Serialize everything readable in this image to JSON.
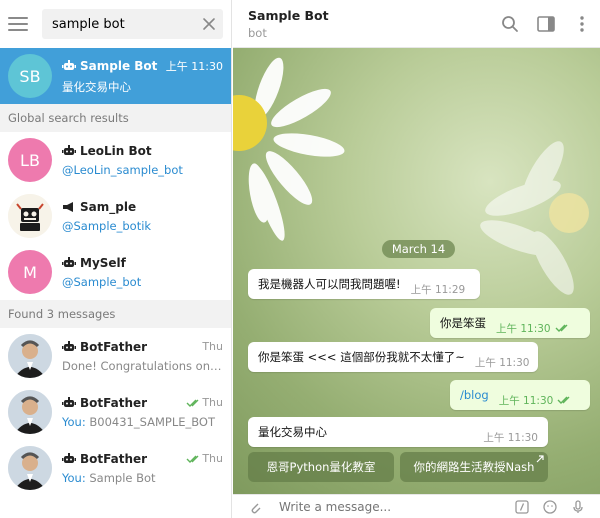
{
  "search": {
    "value": "sample bot"
  },
  "chats": [
    {
      "initials": "SB",
      "name": "Sample Bot",
      "time": "上午 11:30",
      "preview": "量化交易中心",
      "avatar_color": "#5ec5d6"
    }
  ],
  "global_section": "Global search results",
  "global_results": [
    {
      "initials": "LB",
      "name": "LeoLin Bot",
      "username": "@LeoLin_sample_bot",
      "avatar_color": "#ee7aae"
    },
    {
      "name": "Sam_ple",
      "username": "@Sample_botik"
    },
    {
      "initials": "M",
      "name": "MySelf",
      "username": "@Sample_bot",
      "avatar_color": "#ee7aae"
    }
  ],
  "messages_section": "Found 3 messages",
  "found_messages": [
    {
      "name": "BotFather",
      "time": "Thu",
      "preview": "Done! Congratulations on your new bot.",
      "you": ""
    },
    {
      "name": "BotFather",
      "time": "Thu",
      "preview": "B00431_SAMPLE_BOT",
      "you": "You:"
    },
    {
      "name": "BotFather",
      "time": "Thu",
      "preview": "Sample Bot",
      "you": "You:"
    }
  ],
  "header": {
    "title": "Sample Bot",
    "subtitle": "bot"
  },
  "date_label": "March 14",
  "messages": [
    {
      "text": "我是機器人可以問我問題喔!",
      "time": "上午 11:29",
      "out": false
    },
    {
      "text": "你是笨蛋",
      "time": "上午 11:30",
      "out": true
    },
    {
      "text": "你是笨蛋 <<< 這個部份我就不太懂了~",
      "time": "上午 11:30",
      "out": false
    },
    {
      "text": "/blog",
      "time": "上午 11:30",
      "out": true
    },
    {
      "text": "量化交易中心",
      "time": "上午 11:30",
      "out": false
    }
  ],
  "keyboard": [
    {
      "label": "恩哥Python量化教室"
    },
    {
      "label": "你的網路生活教授Nash"
    }
  ],
  "composer": {
    "placeholder": "Write a message..."
  },
  "colors": {
    "accent": "#419fd9",
    "link": "#2a8bd0",
    "out_bubble": "#effdde",
    "check": "#5fb45a"
  }
}
